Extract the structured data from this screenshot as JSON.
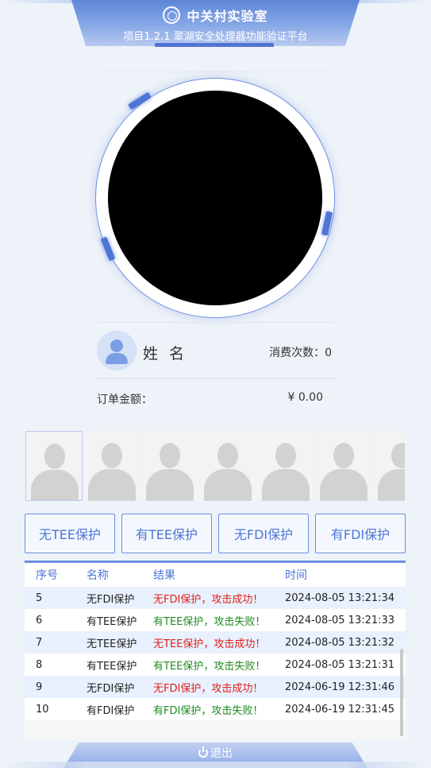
{
  "header": {
    "lab_name": "中关村实验室",
    "project_title": "项目1.2.1 翠湖安全处理器功能验证平台"
  },
  "user": {
    "name": "姓 名",
    "consume_label": "消费次数：0"
  },
  "order": {
    "label": "订单金额：",
    "value": "¥  0.00"
  },
  "modes": [
    {
      "label": "无TEE保护"
    },
    {
      "label": "有TEE保护"
    },
    {
      "label": "无FDI保护"
    },
    {
      "label": "有FDI保护"
    }
  ],
  "table": {
    "columns": [
      "序号",
      "名称",
      "结果",
      "时间"
    ],
    "rows": [
      {
        "no": "5",
        "name": "无FDI保护",
        "result": "无FDI保护，攻击成功！",
        "time": "2024-08-05 13:21:34"
      },
      {
        "no": "6",
        "name": "有TEE保护",
        "result": "有TEE保护，攻击失败！",
        "time": "2024-08-05 13:21:33"
      },
      {
        "no": "7",
        "name": "无TEE保护",
        "result": "无TEE保护，攻击成功！",
        "time": "2024-08-05 13:21:32"
      },
      {
        "no": "8",
        "name": "有TEE保护",
        "result": "有TEE保护，攻击失败！",
        "time": "2024-08-05 13:21:31"
      },
      {
        "no": "9",
        "name": "无FDI保护",
        "result": "无FDI保护，攻击成功！",
        "time": "2024-06-19 12:31:46"
      },
      {
        "no": "10",
        "name": "有FDI保护",
        "result": "有FDI保护，攻击失败！",
        "time": "2024-06-19 12:31:45"
      }
    ]
  },
  "footer": {
    "logout_label": "退出"
  },
  "colors": {
    "accent": "#4f74d6",
    "success_text": "#1e8b1e",
    "danger_text": "#e0201e",
    "camera": "#000000"
  },
  "icons": [
    "lab-logo-icon",
    "user-avatar-icon",
    "power-icon"
  ]
}
